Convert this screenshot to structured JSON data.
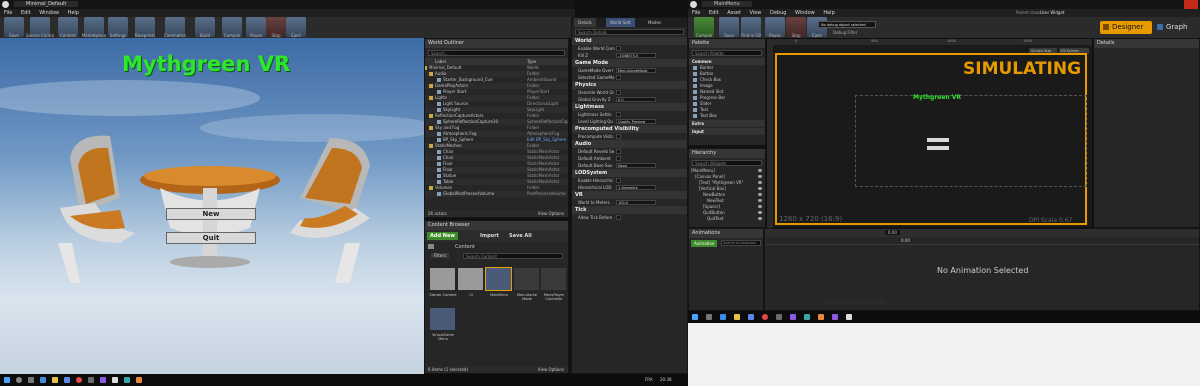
{
  "left_editor": {
    "tab_title": "Minimal_Default",
    "menu": [
      "File",
      "Edit",
      "Window",
      "Help"
    ],
    "toolbar": [
      "Save",
      "Source Control",
      "Content",
      "Marketplace",
      "Settings",
      "Blueprints",
      "Cinematics",
      "Build",
      "Compile",
      "Pause",
      "Stop",
      "Eject"
    ],
    "viewport": {
      "title": "Mythgreen VR",
      "new_label": "New",
      "quit_label": "Quit"
    },
    "world_outliner": {
      "title": "World Outliner",
      "search_placeholder": "Search...",
      "columns": [
        "Label",
        "Type"
      ],
      "rows": [
        {
          "label": "Minimal_Default",
          "type": "World"
        },
        {
          "label": "Audio",
          "type": "Folder"
        },
        {
          "label": "Starter_Background_Cue",
          "type": "AmbientSound"
        },
        {
          "label": "GamePlayActors",
          "type": "Folder"
        },
        {
          "label": "Player Start",
          "type": "PlayerStart"
        },
        {
          "label": "Lights",
          "type": "Folder"
        },
        {
          "label": "Light Source",
          "type": "DirectionalLight"
        },
        {
          "label": "SkyLight",
          "type": "SkyLight"
        },
        {
          "label": "ReflectionCaptureActors",
          "type": "Folder"
        },
        {
          "label": "SphereReflectionCapture10",
          "type": "SphereReflectionCapture"
        },
        {
          "label": "Sky and Fog",
          "type": "Folder"
        },
        {
          "label": "Atmospheric Fog",
          "type": "AtmosphericFog"
        },
        {
          "label": "BP_Sky_Sphere",
          "type": "Edit BP_Sky_Sphere"
        },
        {
          "label": "StaticMeshes",
          "type": "Folder"
        },
        {
          "label": "Chair",
          "type": "StaticMeshActor"
        },
        {
          "label": "Chair",
          "type": "StaticMeshActor"
        },
        {
          "label": "Floor",
          "type": "StaticMeshActor"
        },
        {
          "label": "Floor",
          "type": "StaticMeshActor"
        },
        {
          "label": "Statue",
          "type": "StaticMeshActor"
        },
        {
          "label": "Table",
          "type": "StaticMeshActor"
        },
        {
          "label": "Volumes",
          "type": "Folder"
        },
        {
          "label": "GlobalPostProcessVolume",
          "type": "PostProcessVolume"
        }
      ],
      "footer_count": "26 actors",
      "view_options": "View Options"
    },
    "content_browser": {
      "title": "Content Browser",
      "add_new": "Add New",
      "import": "Import",
      "save_all": "Save All",
      "path": "Content",
      "filters": "Filters",
      "search_placeholder": "Search Content",
      "tiles": [
        "Starter Content",
        "UI",
        "MainMenu",
        "MenuGame Mode",
        "MenuPlayer Controller",
        "VirtualGame Menu"
      ],
      "footer": "6 items (1 selected)",
      "view_options": "View Options"
    },
    "details": {
      "tabs": [
        "Details",
        "World Sett",
        "Modes"
      ],
      "search_placeholder": "Search Details",
      "sections": [
        {
          "title": "World",
          "props": [
            {
              "label": "Enable World Com",
              "value": ""
            },
            {
              "label": "Kill Z",
              "value": "-1048575.0"
            }
          ]
        },
        {
          "title": "Game Mode",
          "props": [
            {
              "label": "GameMode Overr",
              "value": "MenuGameMode"
            },
            {
              "label": "Selected GameMo",
              "value": ""
            }
          ]
        },
        {
          "title": "Physics",
          "props": [
            {
              "label": "Override World Gr",
              "value": ""
            },
            {
              "label": "Global Gravity Z",
              "value": "0.0"
            }
          ]
        },
        {
          "title": "Lightmass",
          "props": [
            {
              "label": "Lightmass Settin",
              "value": ""
            },
            {
              "label": "Level Lighting Qu",
              "value": "Quality Preview"
            }
          ]
        },
        {
          "title": "Precomputed Visibility",
          "props": [
            {
              "label": "Precompute Visib",
              "value": ""
            }
          ]
        },
        {
          "title": "Audio",
          "props": [
            {
              "label": "Default Reverb Se",
              "value": ""
            },
            {
              "label": "Default Ambient",
              "value": ""
            },
            {
              "label": "Default Base Sou",
              "value": "None"
            }
          ]
        },
        {
          "title": "LODSystem",
          "props": [
            {
              "label": "Enable Hierarchic",
              "value": ""
            },
            {
              "label": "Hierarchical LOD",
              "value": "1 elements"
            }
          ]
        },
        {
          "title": "VR",
          "props": [
            {
              "label": "World to Meters",
              "value": "100.0"
            }
          ]
        },
        {
          "title": "Tick",
          "props": [
            {
              "label": "Allow Tick Before",
              "value": ""
            }
          ]
        }
      ]
    },
    "taskbar_time": "20:38",
    "taskbar_lang": "FRA"
  },
  "right_editor": {
    "tab_title": "MainMenu",
    "menu": [
      "File",
      "Edit",
      "Asset",
      "View",
      "Debug",
      "Window",
      "Help"
    ],
    "toolbar": [
      "Compile",
      "Save",
      "Find in CB",
      "Pause",
      "Stop",
      "Eject"
    ],
    "debug_filter_label": "Debug Filter",
    "debug_filter_value": "No debug object selected",
    "parent_class_label": "Parent class:",
    "parent_class_value": "User Widget",
    "mode_designer": "Designer",
    "mode_graph": "Graph",
    "palette": {
      "title": "Palette",
      "search_placeholder": "Search Palette",
      "category": "Common",
      "items": [
        "Border",
        "Button",
        "Check Box",
        "Image",
        "Named Slot",
        "Progress Bar",
        "Slider",
        "Text",
        "Text Box"
      ],
      "extra_categories": [
        "Extra",
        "Input"
      ]
    },
    "hierarchy": {
      "title": "Hierarchy",
      "search_placeholder": "Search Widgets",
      "rows": [
        "[MainMenu]",
        "[Canvas Panel]",
        "[Text] \"Mythgreen VR\"",
        "[Vertical Box]",
        "NewButton",
        "NewText",
        "[Spacer]",
        "QuitButton",
        "QuitText"
      ]
    },
    "canvas": {
      "simulating": "SIMULATING",
      "title": "Mythgreen VR",
      "resolution": "1280 x 720 (16:9)",
      "dpi": "DPI Scale 0.67",
      "screen_size": "Screen Size",
      "fill_screen": "Fill Screen",
      "ruler": [
        "0",
        "500",
        "1000",
        "1500"
      ]
    },
    "details_title": "Details",
    "animations": {
      "title": "Animations",
      "add_label": "Animation",
      "search_placeholder": "Search Animations",
      "empty_text": "No Animation Selected",
      "fps": "0.00",
      "timeline_start": "0.00"
    }
  },
  "colors": {
    "accent_orange": "#e69a00",
    "title_green": "#2ee62e",
    "selection_blue": "#2e4f7a"
  }
}
